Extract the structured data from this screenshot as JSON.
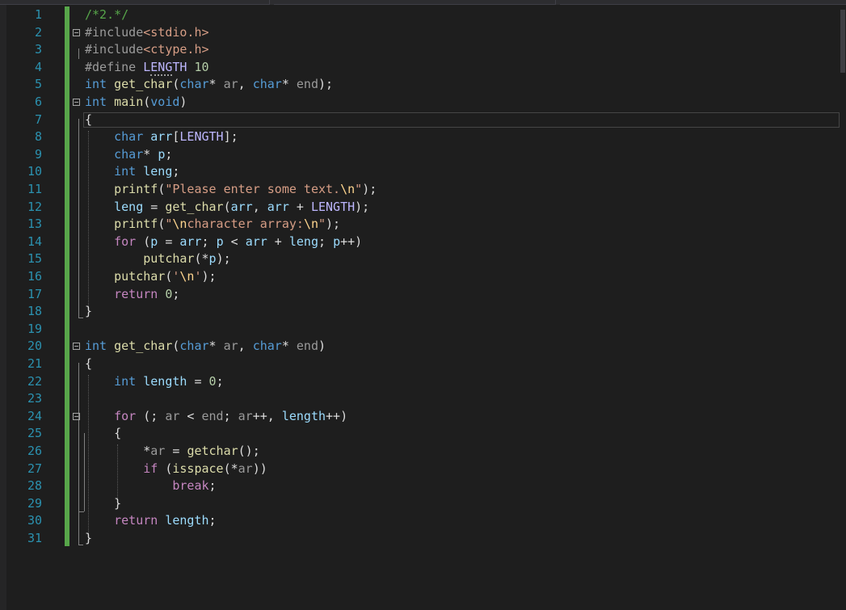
{
  "editor": {
    "lines": [
      {
        "n": "1",
        "tokens": [
          [
            "c",
            "/*2.*/"
          ]
        ]
      },
      {
        "n": "2",
        "tokens": [
          [
            "pp",
            "#include"
          ],
          [
            "s",
            "<stdio.h>"
          ]
        ]
      },
      {
        "n": "3",
        "tokens": [
          [
            "pp",
            "#include"
          ],
          [
            "s",
            "<ctype.h>"
          ]
        ]
      },
      {
        "n": "4",
        "tokens": [
          [
            "pp",
            "#define "
          ],
          [
            "mac",
            "L"
          ],
          [
            "mac sq",
            "ENG"
          ],
          [
            "mac",
            "TH"
          ],
          [
            "t",
            " "
          ],
          [
            "n",
            "10"
          ]
        ]
      },
      {
        "n": "5",
        "tokens": [
          [
            "k",
            "int"
          ],
          [
            "t",
            " "
          ],
          [
            "f",
            "get_char"
          ],
          [
            "t",
            "("
          ],
          [
            "k",
            "char"
          ],
          [
            "t",
            "* "
          ],
          [
            "pa",
            "ar"
          ],
          [
            "t",
            ", "
          ],
          [
            "k",
            "char"
          ],
          [
            "t",
            "* "
          ],
          [
            "pa",
            "end"
          ],
          [
            "t",
            ");"
          ]
        ]
      },
      {
        "n": "6",
        "tokens": [
          [
            "k",
            "int"
          ],
          [
            "t",
            " "
          ],
          [
            "f",
            "main"
          ],
          [
            "t",
            "("
          ],
          [
            "k",
            "void"
          ],
          [
            "t",
            ")"
          ]
        ]
      },
      {
        "n": "7",
        "tokens": [
          [
            "t",
            "{"
          ]
        ]
      },
      {
        "n": "8",
        "tokens": [
          [
            "t",
            "    "
          ],
          [
            "k",
            "char"
          ],
          [
            "t",
            " "
          ],
          [
            "v",
            "arr"
          ],
          [
            "t",
            "["
          ],
          [
            "mac",
            "LENGTH"
          ],
          [
            "t",
            "];"
          ]
        ]
      },
      {
        "n": "9",
        "tokens": [
          [
            "t",
            "    "
          ],
          [
            "k",
            "char"
          ],
          [
            "t",
            "* "
          ],
          [
            "v",
            "p"
          ],
          [
            "t",
            ";"
          ]
        ]
      },
      {
        "n": "10",
        "tokens": [
          [
            "t",
            "    "
          ],
          [
            "k",
            "int"
          ],
          [
            "t",
            " "
          ],
          [
            "v",
            "leng"
          ],
          [
            "t",
            ";"
          ]
        ]
      },
      {
        "n": "11",
        "tokens": [
          [
            "t",
            "    "
          ],
          [
            "f",
            "printf"
          ],
          [
            "t",
            "("
          ],
          [
            "s",
            "\"Please enter some text."
          ],
          [
            "e",
            "\\n"
          ],
          [
            "s",
            "\""
          ],
          [
            "t",
            ");"
          ]
        ]
      },
      {
        "n": "12",
        "tokens": [
          [
            "t",
            "    "
          ],
          [
            "v",
            "leng"
          ],
          [
            "t",
            " = "
          ],
          [
            "f",
            "get_char"
          ],
          [
            "t",
            "("
          ],
          [
            "v",
            "arr"
          ],
          [
            "t",
            ", "
          ],
          [
            "v",
            "arr"
          ],
          [
            "t",
            " + "
          ],
          [
            "mac",
            "LENGTH"
          ],
          [
            "t",
            ");"
          ]
        ]
      },
      {
        "n": "13",
        "tokens": [
          [
            "t",
            "    "
          ],
          [
            "f",
            "printf"
          ],
          [
            "t",
            "("
          ],
          [
            "s",
            "\""
          ],
          [
            "e",
            "\\n"
          ],
          [
            "s",
            "character array:"
          ],
          [
            "e",
            "\\n"
          ],
          [
            "s",
            "\""
          ],
          [
            "t",
            ");"
          ]
        ]
      },
      {
        "n": "14",
        "tokens": [
          [
            "t",
            "    "
          ],
          [
            "p",
            "for"
          ],
          [
            "t",
            " ("
          ],
          [
            "v",
            "p"
          ],
          [
            "t",
            " = "
          ],
          [
            "v",
            "arr"
          ],
          [
            "t",
            "; "
          ],
          [
            "v",
            "p"
          ],
          [
            "t",
            " < "
          ],
          [
            "v",
            "arr"
          ],
          [
            "t",
            " + "
          ],
          [
            "v",
            "leng"
          ],
          [
            "t",
            "; "
          ],
          [
            "v",
            "p"
          ],
          [
            "t",
            "++)"
          ]
        ]
      },
      {
        "n": "15",
        "tokens": [
          [
            "t",
            "        "
          ],
          [
            "f",
            "putchar"
          ],
          [
            "t",
            "(*"
          ],
          [
            "v",
            "p"
          ],
          [
            "t",
            ");"
          ]
        ]
      },
      {
        "n": "16",
        "tokens": [
          [
            "t",
            "    "
          ],
          [
            "f",
            "putchar"
          ],
          [
            "t",
            "("
          ],
          [
            "s",
            "'"
          ],
          [
            "e",
            "\\n"
          ],
          [
            "s",
            "'"
          ],
          [
            "t",
            ");"
          ]
        ]
      },
      {
        "n": "17",
        "tokens": [
          [
            "t",
            "    "
          ],
          [
            "p",
            "return"
          ],
          [
            "t",
            " "
          ],
          [
            "n",
            "0"
          ],
          [
            "t",
            ";"
          ]
        ]
      },
      {
        "n": "18",
        "tokens": [
          [
            "t",
            "}"
          ]
        ]
      },
      {
        "n": "19",
        "tokens": []
      },
      {
        "n": "20",
        "tokens": [
          [
            "k",
            "int"
          ],
          [
            "t",
            " "
          ],
          [
            "f",
            "get_char"
          ],
          [
            "t",
            "("
          ],
          [
            "k",
            "char"
          ],
          [
            "t",
            "* "
          ],
          [
            "pa",
            "ar"
          ],
          [
            "t",
            ", "
          ],
          [
            "k",
            "char"
          ],
          [
            "t",
            "* "
          ],
          [
            "pa",
            "end"
          ],
          [
            "t",
            ")"
          ]
        ]
      },
      {
        "n": "21",
        "tokens": [
          [
            "t",
            "{"
          ]
        ]
      },
      {
        "n": "22",
        "tokens": [
          [
            "t",
            "    "
          ],
          [
            "k",
            "int"
          ],
          [
            "t",
            " "
          ],
          [
            "v",
            "length"
          ],
          [
            "t",
            " = "
          ],
          [
            "n",
            "0"
          ],
          [
            "t",
            ";"
          ]
        ]
      },
      {
        "n": "23",
        "tokens": []
      },
      {
        "n": "24",
        "tokens": [
          [
            "t",
            "    "
          ],
          [
            "p",
            "for"
          ],
          [
            "t",
            " (; "
          ],
          [
            "pa",
            "ar"
          ],
          [
            "t",
            " < "
          ],
          [
            "pa",
            "end"
          ],
          [
            "t",
            "; "
          ],
          [
            "pa",
            "ar"
          ],
          [
            "t",
            "++, "
          ],
          [
            "v",
            "length"
          ],
          [
            "t",
            "++)"
          ]
        ]
      },
      {
        "n": "25",
        "tokens": [
          [
            "t",
            "    {"
          ]
        ]
      },
      {
        "n": "26",
        "tokens": [
          [
            "t",
            "        *"
          ],
          [
            "pa",
            "ar"
          ],
          [
            "t",
            " = "
          ],
          [
            "f",
            "getchar"
          ],
          [
            "t",
            "();"
          ]
        ]
      },
      {
        "n": "27",
        "tokens": [
          [
            "t",
            "        "
          ],
          [
            "p",
            "if"
          ],
          [
            "t",
            " ("
          ],
          [
            "f",
            "isspace"
          ],
          [
            "t",
            "(*"
          ],
          [
            "pa",
            "ar"
          ],
          [
            "t",
            "))"
          ]
        ]
      },
      {
        "n": "28",
        "tokens": [
          [
            "t",
            "            "
          ],
          [
            "p",
            "break"
          ],
          [
            "t",
            ";"
          ]
        ]
      },
      {
        "n": "29",
        "tokens": [
          [
            "t",
            "    }"
          ]
        ]
      },
      {
        "n": "30",
        "tokens": [
          [
            "t",
            "    "
          ],
          [
            "p",
            "return"
          ],
          [
            "t",
            " "
          ],
          [
            "v",
            "length"
          ],
          [
            "t",
            ";"
          ]
        ]
      },
      {
        "n": "31",
        "tokens": [
          [
            "t",
            "}"
          ]
        ]
      }
    ]
  }
}
